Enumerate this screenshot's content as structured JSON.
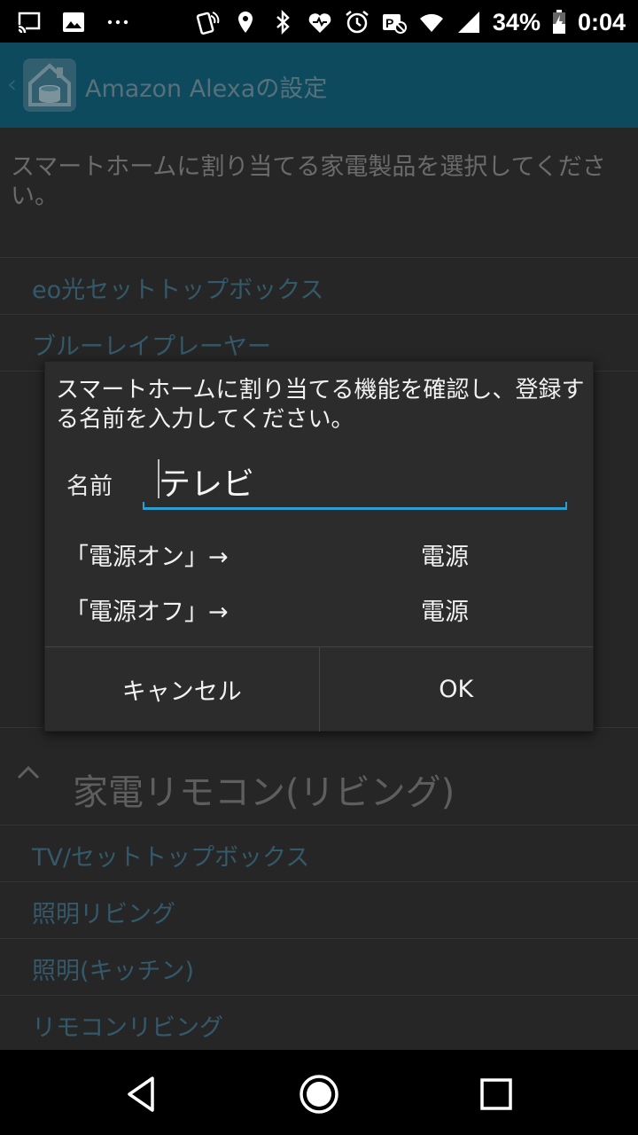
{
  "status_bar": {
    "battery": "34%",
    "time": "0:04"
  },
  "action_bar": {
    "back_glyph": "‹",
    "title": "Amazon Alexaの設定"
  },
  "instruction": "スマートホームに割り当てる家電製品を選択してください。",
  "upper_list": [
    "eo光セットトップボックス",
    "ブルーレイプレーヤー"
  ],
  "section": {
    "title": "家電リモコン(リビング)"
  },
  "lower_list": [
    "TV/セットトップボックス",
    "照明リビング",
    "照明(キッチン)",
    "リモコンリビング"
  ],
  "dialog": {
    "message": "スマートホームに割り当てる機能を確認し、登録する名前を入力してください。",
    "name_label": "名前",
    "name_value": "テレビ",
    "mappings": [
      {
        "command": "「電源オン」→",
        "function": "電源"
      },
      {
        "command": "「電源オフ」→",
        "function": "電源"
      }
    ],
    "cancel_label": "キャンセル",
    "ok_label": "OK"
  },
  "icons": {
    "status_left": [
      "cast-icon",
      "image-icon",
      "more-icon"
    ],
    "status_right": [
      "nfc-icon",
      "location-icon",
      "bluetooth-icon",
      "heart-icon",
      "alarm-icon",
      "data-saver-icon",
      "wifi-icon",
      "cell-signal-icon",
      "battery-icon"
    ],
    "nav": [
      "back-icon",
      "home-icon",
      "recents-icon"
    ]
  },
  "colors": {
    "action_bar": "#0d4a5e",
    "input_underline": "#2a9ed0",
    "list_link": "#34596a",
    "dialog_bg": "#2c2c2c"
  }
}
